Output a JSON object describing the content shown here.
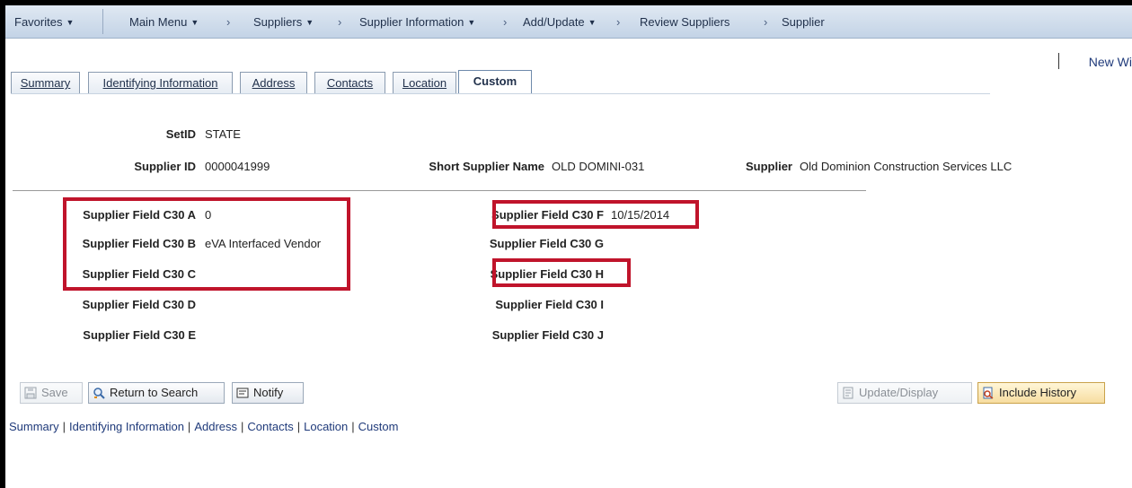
{
  "nav": {
    "favorites": "Favorites",
    "main_menu": "Main Menu",
    "crumbs": [
      "Suppliers",
      "Supplier Information",
      "Add/Update",
      "Review Suppliers",
      "Supplier"
    ],
    "new_window": "New Wi"
  },
  "tabs": [
    {
      "label": "Summary"
    },
    {
      "label": "Identifying Information"
    },
    {
      "label": "Address"
    },
    {
      "label": "Contacts"
    },
    {
      "label": "Location"
    },
    {
      "label": "Custom",
      "active": true
    }
  ],
  "header": {
    "setid_label": "SetID",
    "setid_value": "STATE",
    "supplier_id_label": "Supplier ID",
    "supplier_id_value": "0000041999",
    "short_name_label": "Short Supplier Name",
    "short_name_value": "OLD DOMINI-031",
    "supplier_label": "Supplier",
    "supplier_value": "Old Dominion Construction Services LLC"
  },
  "fields_left": [
    {
      "label": "Supplier Field C30 A",
      "value": "0"
    },
    {
      "label": "Supplier Field C30 B",
      "value": "eVA Interfaced Vendor"
    },
    {
      "label": "Supplier Field C30 C",
      "value": ""
    },
    {
      "label": "Supplier Field C30 D",
      "value": ""
    },
    {
      "label": "Supplier Field C30 E",
      "value": ""
    }
  ],
  "fields_right": [
    {
      "label": "Supplier Field C30 F",
      "value": "10/15/2014"
    },
    {
      "label": "Supplier Field C30 G",
      "value": ""
    },
    {
      "label": "Supplier Field C30 H",
      "value": ""
    },
    {
      "label": "Supplier Field C30 I",
      "value": ""
    },
    {
      "label": "Supplier Field C30 J",
      "value": ""
    }
  ],
  "buttons": {
    "save": "Save",
    "return_to_search": "Return to Search",
    "notify": "Notify",
    "update_display": "Update/Display",
    "include_history": "Include History"
  },
  "footer_links": [
    "Summary",
    "Identifying Information",
    "Address",
    "Contacts",
    "Location",
    "Custom"
  ],
  "colors": {
    "highlight_box": "#c0142b",
    "nav_bg": "#c3d3e6"
  }
}
